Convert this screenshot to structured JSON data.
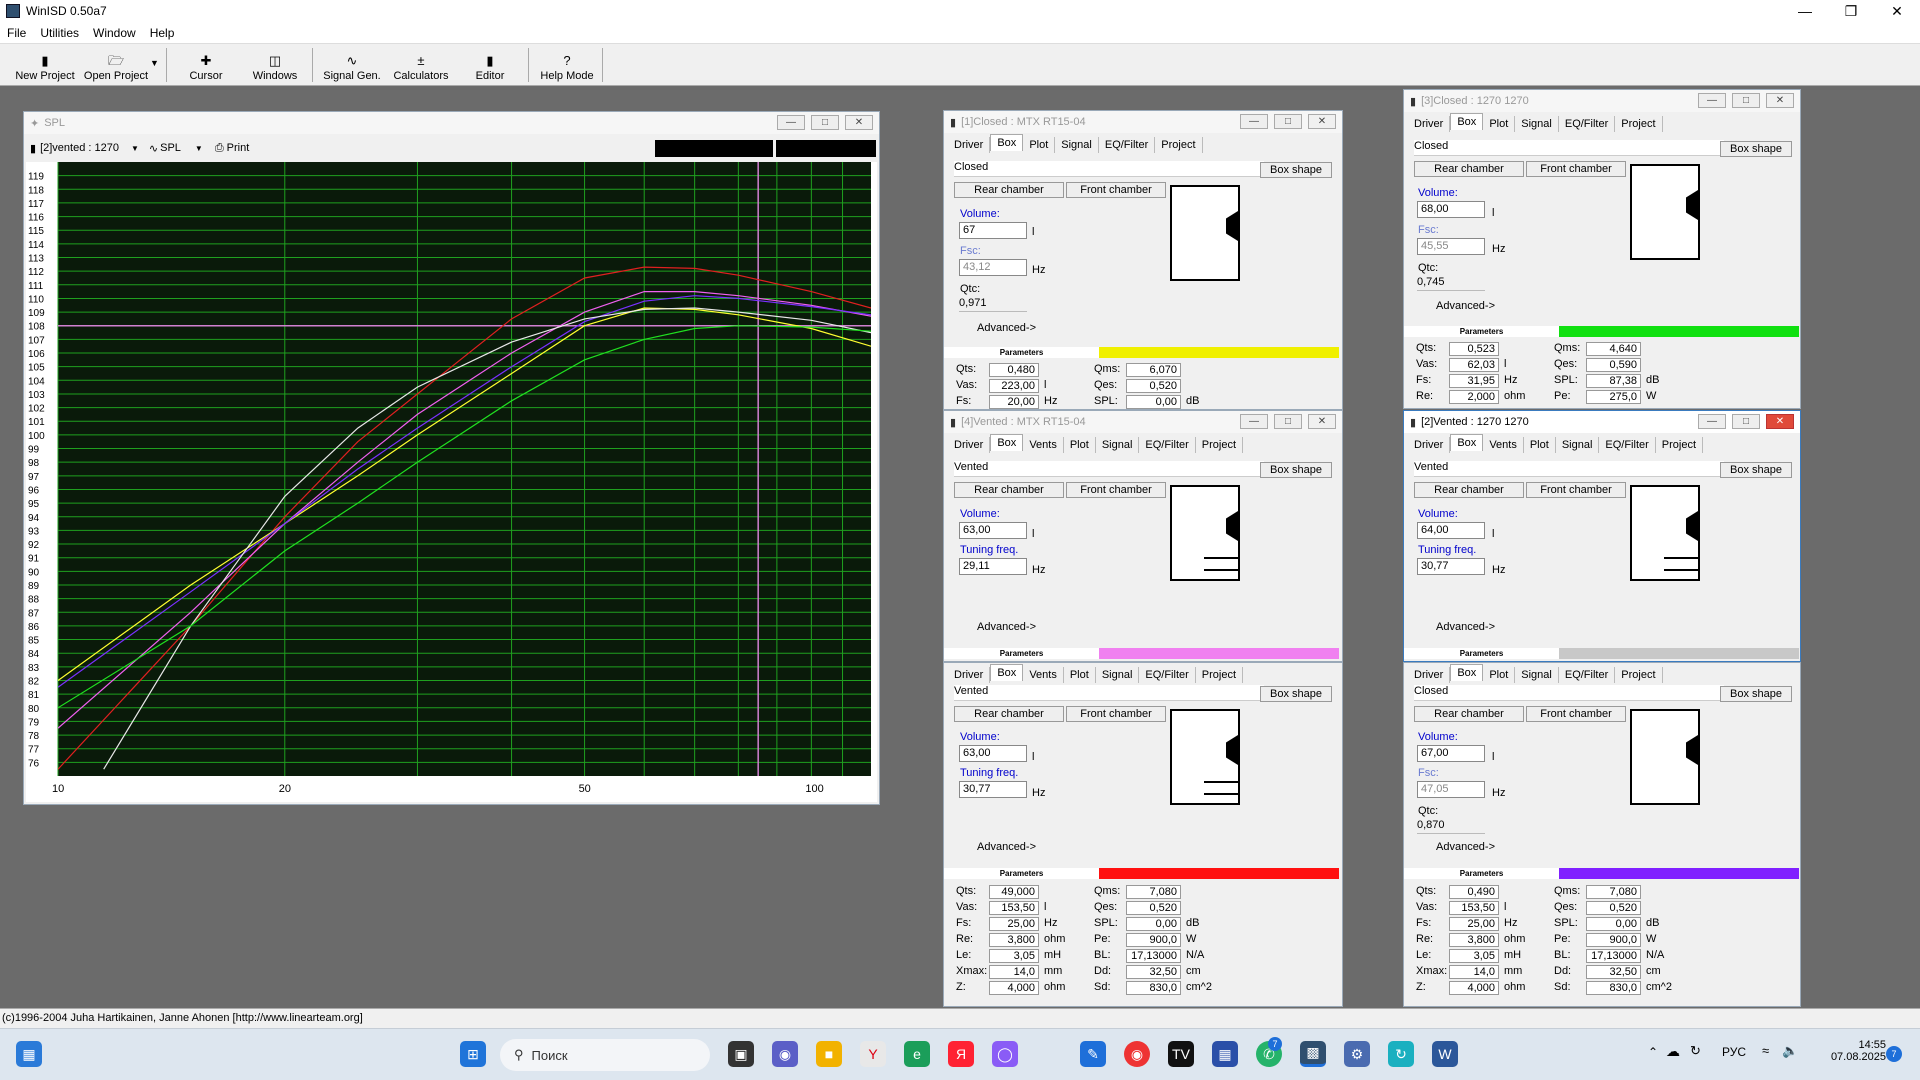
{
  "app": {
    "title": "WinISD 0.50a7"
  },
  "menu": [
    "File",
    "Utilities",
    "Window",
    "Help"
  ],
  "toolbar": {
    "new_project": "New Project",
    "open_project": "Open Project",
    "cursor": "Cursor",
    "windows": "Windows",
    "signal_gen": "Signal Gen.",
    "calculators": "Calculators",
    "editor": "Editor",
    "help_mode": "Help Mode"
  },
  "spl": {
    "title": "SPL",
    "project_select": "[2]vented : 1270",
    "graph_select": "SPL",
    "print": "Print",
    "y_ticks": [
      "119",
      "118",
      "117",
      "116",
      "115",
      "114",
      "113",
      "112",
      "111",
      "110",
      "109",
      "108",
      "107",
      "106",
      "105",
      "104",
      "103",
      "102",
      "101",
      "100",
      "99",
      "98",
      "97",
      "96",
      "95",
      "94",
      "93",
      "92",
      "91",
      "90",
      "89",
      "88",
      "87",
      "86",
      "85",
      "84",
      "83",
      "82",
      "81",
      "80",
      "79",
      "78",
      "77",
      "76"
    ],
    "x_ticks": [
      "10",
      "20",
      "50",
      "100"
    ],
    "colors": {
      "bg": "#0a1a0a",
      "grid": "#1fa01f",
      "cursor": "#d080d0"
    }
  },
  "chart_data": {
    "type": "line",
    "xlabel": "",
    "ylabel": "",
    "x_scale": "log",
    "xlim": [
      10,
      120
    ],
    "ylim": [
      75,
      120
    ],
    "grid": true,
    "series": [
      {
        "color": "#e02020",
        "x": [
          10,
          15,
          20,
          25,
          30,
          40,
          50,
          60,
          70,
          80,
          100,
          120
        ],
        "y": [
          75.5,
          86,
          94,
          99.5,
          103,
          108.5,
          111.5,
          112.3,
          112.2,
          111.7,
          110.5,
          109.3
        ]
      },
      {
        "color": "#ffff30",
        "x": [
          10,
          15,
          20,
          25,
          30,
          40,
          50,
          60,
          70,
          80,
          100,
          120
        ],
        "y": [
          82,
          89,
          93.5,
          97,
          100,
          104.5,
          108,
          109.3,
          109.2,
          108.8,
          107.8,
          106.5
        ]
      },
      {
        "color": "#f060f0",
        "x": [
          10,
          15,
          20,
          25,
          30,
          40,
          50,
          60,
          70,
          80,
          100,
          120
        ],
        "y": [
          78.5,
          87,
          93.5,
          98,
          101.5,
          106,
          109,
          110.5,
          110.5,
          110.2,
          109.5,
          108.7
        ]
      },
      {
        "color": "#7a30ff",
        "x": [
          10,
          15,
          20,
          25,
          30,
          40,
          50,
          60,
          70,
          80,
          100,
          120
        ],
        "y": [
          81.5,
          88.5,
          93.5,
          97.5,
          100.5,
          105,
          108.3,
          109.8,
          110.2,
          110,
          109.4,
          108.8
        ]
      },
      {
        "color": "#e8e8e8",
        "x": [
          11.5,
          15,
          20,
          25,
          30,
          40,
          50,
          60,
          70,
          80,
          100,
          120
        ],
        "y": [
          75.5,
          86,
          95.5,
          100.5,
          103.5,
          106.8,
          108.5,
          109.2,
          109.3,
          109,
          108.4,
          107.5
        ]
      },
      {
        "color": "#20e020",
        "x": [
          10,
          15,
          20,
          25,
          30,
          40,
          50,
          60,
          70,
          80,
          100,
          120
        ],
        "y": [
          80,
          86,
          91.5,
          95,
          98,
          102.5,
          105.5,
          107,
          107.8,
          108,
          107.9,
          107.6
        ]
      }
    ]
  },
  "windows": {
    "w1": {
      "title": "[1]Closed : MTX RT15-04",
      "tabs": [
        "Driver",
        "Box",
        "Plot",
        "Signal",
        "EQ/Filter",
        "Project"
      ],
      "box_type": "Closed",
      "box_shape": "Box shape",
      "rear": "Rear chamber",
      "front": "Front chamber",
      "volume_label": "Volume:",
      "volume": "67",
      "volume_unit": "l",
      "f_label": "Fsc:",
      "f_value": "43,12",
      "f_unit": "Hz",
      "q_label": "Qtc:",
      "q_value": "0,971",
      "advanced": "Advanced->",
      "params_hdr": "Parameters",
      "params_color": "#f0f000",
      "params": [
        {
          "l": "Qts:",
          "v": "0,480",
          "u": "",
          "l2": "Qms:",
          "v2": "6,070",
          "u2": ""
        },
        {
          "l": "Vas:",
          "v": "223,00",
          "u": "l",
          "l2": "Qes:",
          "v2": "0,520",
          "u2": ""
        },
        {
          "l": "Fs:",
          "v": "20,00",
          "u": "Hz",
          "l2": "SPL:",
          "v2": "0,00",
          "u2": "dB"
        }
      ]
    },
    "w3": {
      "title": "[3]Closed : 1270 1270",
      "tabs": [
        "Driver",
        "Box",
        "Plot",
        "Signal",
        "EQ/Filter",
        "Project"
      ],
      "box_type": "Closed",
      "box_shape": "Box shape",
      "rear": "Rear chamber",
      "front": "Front chamber",
      "volume_label": "Volume:",
      "volume": "68,00",
      "volume_unit": "l",
      "f_label": "Fsc:",
      "f_value": "45,55",
      "f_unit": "Hz",
      "q_label": "Qtc:",
      "q_value": "0,745",
      "advanced": "Advanced->",
      "params_hdr": "Parameters",
      "params_color": "#10e010",
      "params": [
        {
          "l": "Qts:",
          "v": "0,523",
          "u": "",
          "l2": "Qms:",
          "v2": "4,640",
          "u2": ""
        },
        {
          "l": "Vas:",
          "v": "62,03",
          "u": "l",
          "l2": "Qes:",
          "v2": "0,590",
          "u2": ""
        },
        {
          "l": "Fs:",
          "v": "31,95",
          "u": "Hz",
          "l2": "SPL:",
          "v2": "87,38",
          "u2": "dB"
        },
        {
          "l": "Re:",
          "v": "2,000",
          "u": "ohm",
          "l2": "Pe:",
          "v2": "275,0",
          "u2": "W"
        }
      ]
    },
    "w4": {
      "title": "[4]Vented : MTX RT15-04",
      "tabs": [
        "Driver",
        "Box",
        "Vents",
        "Plot",
        "Signal",
        "EQ/Filter",
        "Project"
      ],
      "box_type": "Vented",
      "box_shape": "Box shape",
      "rear": "Rear chamber",
      "front": "Front chamber",
      "volume_label": "Volume:",
      "volume": "63,00",
      "volume_unit": "l",
      "f_label": "Tuning freq.",
      "f_value": "29,11",
      "f_unit": "Hz",
      "advanced": "Advanced->",
      "params_hdr": "Parameters",
      "params_color": "#f080f0"
    },
    "w2": {
      "title": "[2]Vented : 1270 1270",
      "tabs": [
        "Driver",
        "Box",
        "Vents",
        "Plot",
        "Signal",
        "EQ/Filter",
        "Project"
      ],
      "box_type": "Vented",
      "box_shape": "Box shape",
      "rear": "Rear chamber",
      "front": "Front chamber",
      "volume_label": "Volume:",
      "volume": "64,00",
      "volume_unit": "l",
      "f_label": "Tuning freq.",
      "f_value": "30,77",
      "f_unit": "Hz",
      "advanced": "Advanced->",
      "params_hdr": "Parameters",
      "params_color": "#c8c8c8"
    },
    "w5": {
      "tabs": [
        "Driver",
        "Box",
        "Vents",
        "Plot",
        "Signal",
        "EQ/Filter",
        "Project"
      ],
      "box_type": "Vented",
      "box_shape": "Box shape",
      "rear": "Rear chamber",
      "front": "Front chamber",
      "volume_label": "Volume:",
      "volume": "63,00",
      "volume_unit": "l",
      "f_label": "Tuning freq.",
      "f_value": "30,77",
      "f_unit": "Hz",
      "advanced": "Advanced->",
      "params_hdr": "Parameters",
      "params_color": "#ff1010",
      "params": [
        {
          "l": "Qts:",
          "v": "49,000",
          "u": "",
          "l2": "Qms:",
          "v2": "7,080",
          "u2": ""
        },
        {
          "l": "Vas:",
          "v": "153,50",
          "u": "l",
          "l2": "Qes:",
          "v2": "0,520",
          "u2": ""
        },
        {
          "l": "Fs:",
          "v": "25,00",
          "u": "Hz",
          "l2": "SPL:",
          "v2": "0,00",
          "u2": "dB"
        },
        {
          "l": "Re:",
          "v": "3,800",
          "u": "ohm",
          "l2": "Pe:",
          "v2": "900,0",
          "u2": "W"
        },
        {
          "l": "Le:",
          "v": "3,05",
          "u": "mH",
          "l2": "BL:",
          "v2": "17,13000",
          "u2": "N/A"
        },
        {
          "l": "Xmax:",
          "v": "14,0",
          "u": "mm",
          "l2": "Dd:",
          "v2": "32,50",
          "u2": "cm"
        },
        {
          "l": "Z:",
          "v": "4,000",
          "u": "ohm",
          "l2": "Sd:",
          "v2": "830,0",
          "u2": "cm^2"
        }
      ]
    },
    "w6": {
      "tabs": [
        "Driver",
        "Box",
        "Plot",
        "Signal",
        "EQ/Filter",
        "Project"
      ],
      "box_type": "Closed",
      "box_shape": "Box shape",
      "rear": "Rear chamber",
      "front": "Front chamber",
      "volume_label": "Volume:",
      "volume": "67,00",
      "volume_unit": "l",
      "f_label": "Fsc:",
      "f_value": "47,05",
      "f_unit": "Hz",
      "q_label": "Qtc:",
      "q_value": "0,870",
      "advanced": "Advanced->",
      "params_hdr": "Parameters",
      "params_color": "#8020ff",
      "params": [
        {
          "l": "Qts:",
          "v": "0,490",
          "u": "",
          "l2": "Qms:",
          "v2": "7,080",
          "u2": ""
        },
        {
          "l": "Vas:",
          "v": "153,50",
          "u": "l",
          "l2": "Qes:",
          "v2": "0,520",
          "u2": ""
        },
        {
          "l": "Fs:",
          "v": "25,00",
          "u": "Hz",
          "l2": "SPL:",
          "v2": "0,00",
          "u2": "dB"
        },
        {
          "l": "Re:",
          "v": "3,800",
          "u": "ohm",
          "l2": "Pe:",
          "v2": "900,0",
          "u2": "W"
        },
        {
          "l": "Le:",
          "v": "3,05",
          "u": "mH",
          "l2": "BL:",
          "v2": "17,13000",
          "u2": "N/A"
        },
        {
          "l": "Xmax:",
          "v": "14,0",
          "u": "mm",
          "l2": "Dd:",
          "v2": "32,50",
          "u2": "cm"
        },
        {
          "l": "Z:",
          "v": "4,000",
          "u": "ohm",
          "l2": "Sd:",
          "v2": "830,0",
          "u2": "cm^2"
        }
      ]
    }
  },
  "status": "(c)1996-2004 Juha Hartikainen, Janne Ahonen [http://www.linearteam.org]",
  "taskbar": {
    "search": "Поиск",
    "lang": "РУС",
    "time": "14:55",
    "date": "07.08.2025",
    "badge": "7"
  }
}
